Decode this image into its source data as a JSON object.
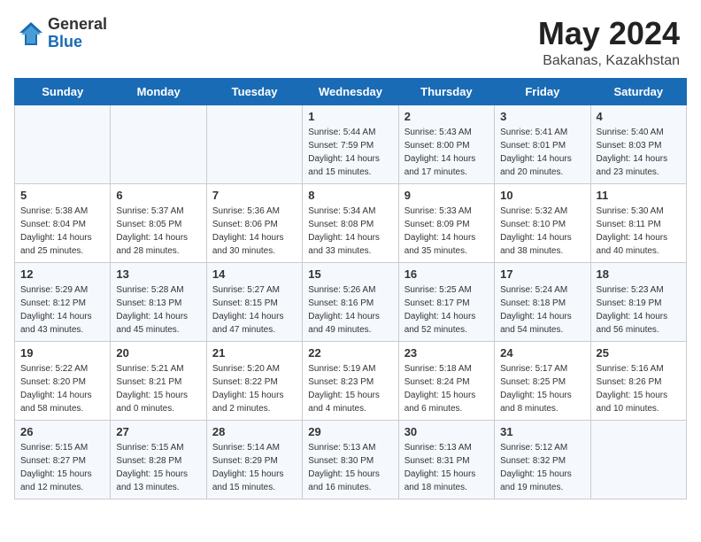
{
  "header": {
    "logo_general": "General",
    "logo_blue": "Blue",
    "month": "May 2024",
    "location": "Bakanas, Kazakhstan"
  },
  "weekdays": [
    "Sunday",
    "Monday",
    "Tuesday",
    "Wednesday",
    "Thursday",
    "Friday",
    "Saturday"
  ],
  "weeks": [
    [
      {
        "day": "",
        "info": ""
      },
      {
        "day": "",
        "info": ""
      },
      {
        "day": "",
        "info": ""
      },
      {
        "day": "1",
        "info": "Sunrise: 5:44 AM\nSunset: 7:59 PM\nDaylight: 14 hours\nand 15 minutes."
      },
      {
        "day": "2",
        "info": "Sunrise: 5:43 AM\nSunset: 8:00 PM\nDaylight: 14 hours\nand 17 minutes."
      },
      {
        "day": "3",
        "info": "Sunrise: 5:41 AM\nSunset: 8:01 PM\nDaylight: 14 hours\nand 20 minutes."
      },
      {
        "day": "4",
        "info": "Sunrise: 5:40 AM\nSunset: 8:03 PM\nDaylight: 14 hours\nand 23 minutes."
      }
    ],
    [
      {
        "day": "5",
        "info": "Sunrise: 5:38 AM\nSunset: 8:04 PM\nDaylight: 14 hours\nand 25 minutes."
      },
      {
        "day": "6",
        "info": "Sunrise: 5:37 AM\nSunset: 8:05 PM\nDaylight: 14 hours\nand 28 minutes."
      },
      {
        "day": "7",
        "info": "Sunrise: 5:36 AM\nSunset: 8:06 PM\nDaylight: 14 hours\nand 30 minutes."
      },
      {
        "day": "8",
        "info": "Sunrise: 5:34 AM\nSunset: 8:08 PM\nDaylight: 14 hours\nand 33 minutes."
      },
      {
        "day": "9",
        "info": "Sunrise: 5:33 AM\nSunset: 8:09 PM\nDaylight: 14 hours\nand 35 minutes."
      },
      {
        "day": "10",
        "info": "Sunrise: 5:32 AM\nSunset: 8:10 PM\nDaylight: 14 hours\nand 38 minutes."
      },
      {
        "day": "11",
        "info": "Sunrise: 5:30 AM\nSunset: 8:11 PM\nDaylight: 14 hours\nand 40 minutes."
      }
    ],
    [
      {
        "day": "12",
        "info": "Sunrise: 5:29 AM\nSunset: 8:12 PM\nDaylight: 14 hours\nand 43 minutes."
      },
      {
        "day": "13",
        "info": "Sunrise: 5:28 AM\nSunset: 8:13 PM\nDaylight: 14 hours\nand 45 minutes."
      },
      {
        "day": "14",
        "info": "Sunrise: 5:27 AM\nSunset: 8:15 PM\nDaylight: 14 hours\nand 47 minutes."
      },
      {
        "day": "15",
        "info": "Sunrise: 5:26 AM\nSunset: 8:16 PM\nDaylight: 14 hours\nand 49 minutes."
      },
      {
        "day": "16",
        "info": "Sunrise: 5:25 AM\nSunset: 8:17 PM\nDaylight: 14 hours\nand 52 minutes."
      },
      {
        "day": "17",
        "info": "Sunrise: 5:24 AM\nSunset: 8:18 PM\nDaylight: 14 hours\nand 54 minutes."
      },
      {
        "day": "18",
        "info": "Sunrise: 5:23 AM\nSunset: 8:19 PM\nDaylight: 14 hours\nand 56 minutes."
      }
    ],
    [
      {
        "day": "19",
        "info": "Sunrise: 5:22 AM\nSunset: 8:20 PM\nDaylight: 14 hours\nand 58 minutes."
      },
      {
        "day": "20",
        "info": "Sunrise: 5:21 AM\nSunset: 8:21 PM\nDaylight: 15 hours\nand 0 minutes."
      },
      {
        "day": "21",
        "info": "Sunrise: 5:20 AM\nSunset: 8:22 PM\nDaylight: 15 hours\nand 2 minutes."
      },
      {
        "day": "22",
        "info": "Sunrise: 5:19 AM\nSunset: 8:23 PM\nDaylight: 15 hours\nand 4 minutes."
      },
      {
        "day": "23",
        "info": "Sunrise: 5:18 AM\nSunset: 8:24 PM\nDaylight: 15 hours\nand 6 minutes."
      },
      {
        "day": "24",
        "info": "Sunrise: 5:17 AM\nSunset: 8:25 PM\nDaylight: 15 hours\nand 8 minutes."
      },
      {
        "day": "25",
        "info": "Sunrise: 5:16 AM\nSunset: 8:26 PM\nDaylight: 15 hours\nand 10 minutes."
      }
    ],
    [
      {
        "day": "26",
        "info": "Sunrise: 5:15 AM\nSunset: 8:27 PM\nDaylight: 15 hours\nand 12 minutes."
      },
      {
        "day": "27",
        "info": "Sunrise: 5:15 AM\nSunset: 8:28 PM\nDaylight: 15 hours\nand 13 minutes."
      },
      {
        "day": "28",
        "info": "Sunrise: 5:14 AM\nSunset: 8:29 PM\nDaylight: 15 hours\nand 15 minutes."
      },
      {
        "day": "29",
        "info": "Sunrise: 5:13 AM\nSunset: 8:30 PM\nDaylight: 15 hours\nand 16 minutes."
      },
      {
        "day": "30",
        "info": "Sunrise: 5:13 AM\nSunset: 8:31 PM\nDaylight: 15 hours\nand 18 minutes."
      },
      {
        "day": "31",
        "info": "Sunrise: 5:12 AM\nSunset: 8:32 PM\nDaylight: 15 hours\nand 19 minutes."
      },
      {
        "day": "",
        "info": ""
      }
    ]
  ]
}
